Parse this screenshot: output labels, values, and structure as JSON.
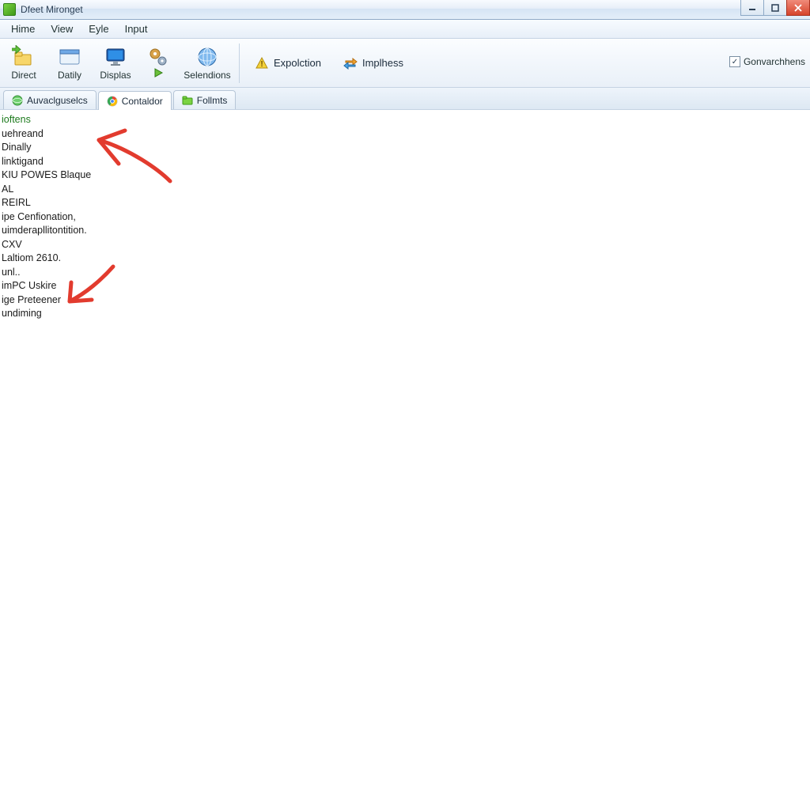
{
  "window": {
    "title": "Dfeet Mironget"
  },
  "menu": {
    "items": [
      "Hime",
      "View",
      "Eyle",
      "Input"
    ]
  },
  "toolbar": {
    "btn_direct": "Direct",
    "btn_datily": "Datily",
    "btn_displas": "Displas",
    "btn_play": "",
    "btn_selendions": "Selendions",
    "btn_expolction": "Expolction",
    "btn_implies": "Implhess",
    "checkbox_label": "Gonvarchhens",
    "checkbox_checked": true
  },
  "tabs": [
    {
      "label": "Auvaclguselcs",
      "icon": "globe-icon",
      "active": false
    },
    {
      "label": "Contaldor",
      "icon": "chrome-icon",
      "active": true
    },
    {
      "label": "Follmts",
      "icon": "folder-green-icon",
      "active": false
    }
  ],
  "list_header": "ioftens",
  "list_items": [
    "uehreand",
    "Dinally",
    "linktigand",
    "KIU POWES Blaque",
    "AL",
    "REIRL",
    "ipe Cenfionation,",
    "uimderapllitontition.",
    "CXV",
    "Laltiom 2610.",
    "unl..",
    "imPC Uskire",
    "ige Preteener",
    "undiming"
  ]
}
